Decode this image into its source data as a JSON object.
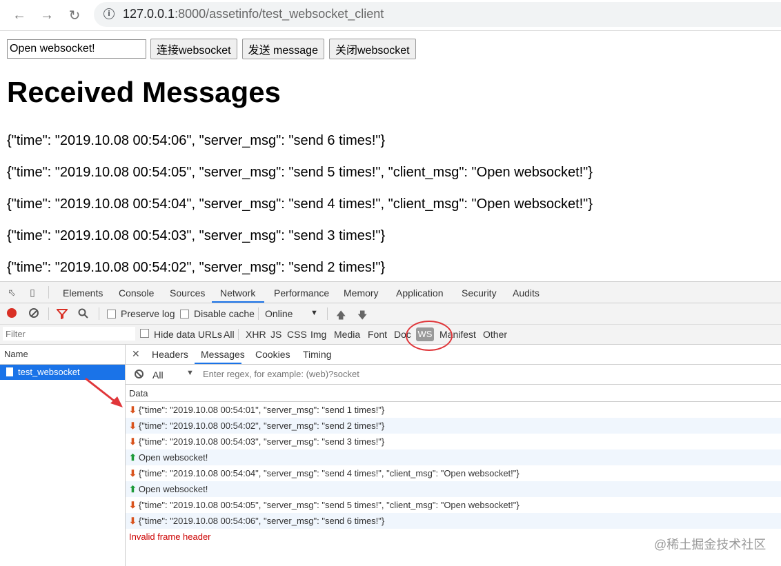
{
  "browser": {
    "url_host": "127.0.0.1",
    "url_path": ":8000/assetinfo/test_websocket_client"
  },
  "page": {
    "input_value": "Open websocket!",
    "buttons": {
      "connect": "连接websocket",
      "send": "发送 message",
      "close": "关闭websocket"
    },
    "heading": "Received Messages",
    "messages": [
      "{\"time\": \"2019.10.08 00:54:06\", \"server_msg\": \"send 6 times!\"}",
      "{\"time\": \"2019.10.08 00:54:05\", \"server_msg\": \"send 5 times!\", \"client_msg\": \"Open websocket!\"}",
      "{\"time\": \"2019.10.08 00:54:04\", \"server_msg\": \"send 4 times!\", \"client_msg\": \"Open websocket!\"}",
      "{\"time\": \"2019.10.08 00:54:03\", \"server_msg\": \"send 3 times!\"}",
      "{\"time\": \"2019.10.08 00:54:02\", \"server_msg\": \"send 2 times!\"}"
    ]
  },
  "devtools": {
    "tabs": [
      "Elements",
      "Console",
      "Sources",
      "Network",
      "Performance",
      "Memory",
      "Application",
      "Security",
      "Audits"
    ],
    "active_tab": "Network",
    "toolbar": {
      "preserve_log": "Preserve log",
      "disable_cache": "Disable cache",
      "throttle": "Online"
    },
    "filter": {
      "placeholder": "Filter",
      "hide_data_urls": "Hide data URLs",
      "types": [
        "All",
        "XHR",
        "JS",
        "CSS",
        "Img",
        "Media",
        "Font",
        "Doc",
        "WS",
        "Manifest",
        "Other"
      ],
      "active_type": "WS"
    },
    "name_header": "Name",
    "request_name": "test_websocket",
    "detail_tabs": [
      "Headers",
      "Messages",
      "Cookies",
      "Timing"
    ],
    "active_detail_tab": "Messages",
    "message_filter": {
      "level": "All",
      "placeholder": "Enter regex, for example: (web)?socket"
    },
    "data_header": "Data",
    "frames": [
      {
        "dir": "down",
        "text": "{\"time\": \"2019.10.08 00:54:01\", \"server_msg\": \"send 1 times!\"}"
      },
      {
        "dir": "down",
        "text": "{\"time\": \"2019.10.08 00:54:02\", \"server_msg\": \"send 2 times!\"}"
      },
      {
        "dir": "down",
        "text": "{\"time\": \"2019.10.08 00:54:03\", \"server_msg\": \"send 3 times!\"}"
      },
      {
        "dir": "up",
        "text": "Open websocket!"
      },
      {
        "dir": "down",
        "text": "{\"time\": \"2019.10.08 00:54:04\", \"server_msg\": \"send 4 times!\", \"client_msg\": \"Open websocket!\"}"
      },
      {
        "dir": "up",
        "text": "Open websocket!"
      },
      {
        "dir": "down",
        "text": "{\"time\": \"2019.10.08 00:54:05\", \"server_msg\": \"send 5 times!\", \"client_msg\": \"Open websocket!\"}"
      },
      {
        "dir": "down",
        "text": "{\"time\": \"2019.10.08 00:54:06\", \"server_msg\": \"send 6 times!\"}"
      }
    ],
    "error_frame": "Invalid frame header"
  },
  "watermark": "@稀土掘金技术社区",
  "icons": {
    "arrow_down": "⬇",
    "arrow_up": "⬆"
  }
}
